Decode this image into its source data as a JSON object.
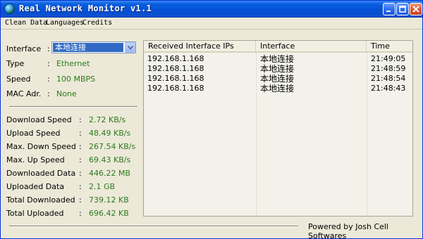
{
  "window": {
    "title": "Real Network Monitor v1.1",
    "accent": "#0452d8"
  },
  "menu": {
    "items": [
      "Clean Data",
      "Languages",
      "Credits"
    ]
  },
  "interface": {
    "label": "Interface",
    "selected": "本地连接",
    "type_label": "Type",
    "type_value": "Ethernet",
    "speed_label": "Speed",
    "speed_value": "100 MBPS",
    "mac_label": "MAC Adr.",
    "mac_value": "None"
  },
  "stats": [
    {
      "label": "Download Speed",
      "value": "2.72 KB/s"
    },
    {
      "label": "Upload Speed",
      "value": "48.49 KB/s"
    },
    {
      "label": "Max. Down Speed",
      "value": "267.54 KB/s"
    },
    {
      "label": "Max. Up Speed",
      "value": "69.43 KB/s"
    },
    {
      "label": "Downloaded Data",
      "value": "446.22 MB"
    },
    {
      "label": "Uploaded Data",
      "value": "2.1 GB"
    },
    {
      "label": "Total Downloaded",
      "value": "739.12 KB"
    },
    {
      "label": "Total Uploaded",
      "value": "696.42 KB"
    }
  ],
  "table": {
    "headers": [
      "Received Interface IPs",
      "Interface",
      "Time"
    ],
    "rows": [
      {
        "ip": "192.168.1.168",
        "interface": "本地连接",
        "time": "21:49:05"
      },
      {
        "ip": "192.168.1.168",
        "interface": "本地连接",
        "time": "21:48:59"
      },
      {
        "ip": "192.168.1.168",
        "interface": "本地连接",
        "time": "21:48:54"
      },
      {
        "ip": "192.168.1.168",
        "interface": "本地连接",
        "time": "21:48:43"
      }
    ]
  },
  "footer": {
    "powered_by": "Powered by Josh Cell Softwares"
  },
  "colors": {
    "value_green": "#2d7a1f",
    "selection_blue": "#316ac5"
  }
}
